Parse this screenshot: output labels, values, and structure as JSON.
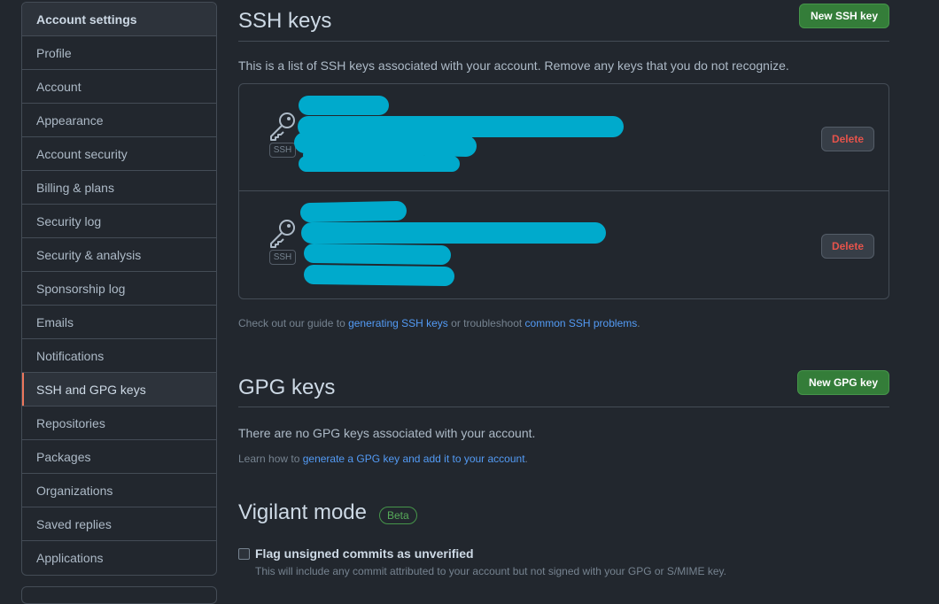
{
  "sidebar": {
    "heading": "Account settings",
    "items": [
      {
        "label": "Profile"
      },
      {
        "label": "Account"
      },
      {
        "label": "Appearance"
      },
      {
        "label": "Account security"
      },
      {
        "label": "Billing & plans"
      },
      {
        "label": "Security log"
      },
      {
        "label": "Security & analysis"
      },
      {
        "label": "Sponsorship log"
      },
      {
        "label": "Emails"
      },
      {
        "label": "Notifications"
      },
      {
        "label": "SSH and GPG keys"
      },
      {
        "label": "Repositories"
      },
      {
        "label": "Packages"
      },
      {
        "label": "Organizations"
      },
      {
        "label": "Saved replies"
      },
      {
        "label": "Applications"
      }
    ],
    "active": "SSH and GPG keys"
  },
  "ssh": {
    "title": "SSH keys",
    "new_button": "New SSH key",
    "description": "This is a list of SSH keys associated with your account. Remove any keys that you do not recognize.",
    "keys": [
      {
        "type_label": "SSH",
        "delete_label": "Delete"
      },
      {
        "type_label": "SSH",
        "delete_label": "Delete"
      }
    ],
    "guide": {
      "prefix": "Check out our guide to ",
      "link1": "generating SSH keys",
      "middle": " or troubleshoot ",
      "link2": "common SSH problems",
      "suffix": "."
    }
  },
  "gpg": {
    "title": "GPG keys",
    "new_button": "New GPG key",
    "empty_text": "There are no GPG keys associated with your account.",
    "learn": {
      "prefix": "Learn how to ",
      "link": "generate a GPG key and add it to your account",
      "suffix": "."
    }
  },
  "vigilant": {
    "title": "Vigilant mode",
    "badge": "Beta",
    "checkbox_label": "Flag unsigned commits as unverified",
    "checkbox_note": "This will include any commit attributed to your account but not signed with your GPG or S/MIME key.",
    "checked": false
  },
  "colors": {
    "redaction": "#00aacc",
    "accent_active": "#ec775c",
    "primary_button": "#347d39",
    "danger_text": "#e5534b"
  }
}
